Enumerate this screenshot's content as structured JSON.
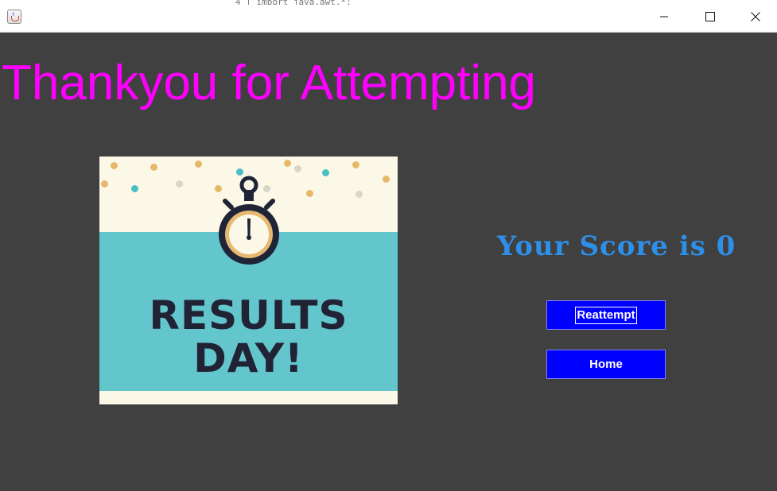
{
  "window": {
    "behind_text": "4  |   import java.awt.*;",
    "minimize_icon": "minimize-icon",
    "maximize_icon": "maximize-icon",
    "close_icon": "close-icon",
    "app_icon": "java-cup-icon"
  },
  "main": {
    "heading": "Thankyou for Attempting",
    "score_text": "Your Score is 0",
    "image": {
      "line1": "RESULTS",
      "line2": "DAY!"
    },
    "buttons": {
      "reattempt": "Reattempt",
      "home": "Home"
    }
  },
  "colors": {
    "background": "#404040",
    "heading": "#ff00ff",
    "score": "#2e8fe8",
    "button": "#0000ff",
    "button_text": "#ffffff"
  }
}
